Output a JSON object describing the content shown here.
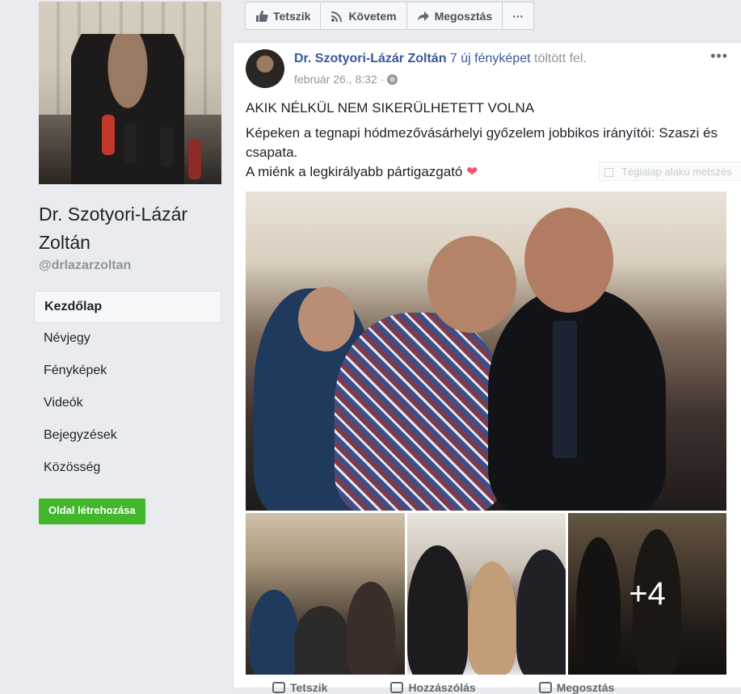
{
  "sidebar": {
    "page_name": "Dr. Szotyori-Lázár Zoltán",
    "page_handle": "@drlazarzoltan",
    "nav_items": [
      {
        "label": "Kezdőlap",
        "active": true
      },
      {
        "label": "Névjegy",
        "active": false
      },
      {
        "label": "Fényképek",
        "active": false
      },
      {
        "label": "Videók",
        "active": false
      },
      {
        "label": "Bejegyzések",
        "active": false
      },
      {
        "label": "Közösség",
        "active": false
      }
    ],
    "create_page_label": "Oldal létrehozása"
  },
  "action_bar": {
    "like_label": "Tetszik",
    "follow_label": "Követem",
    "share_label": "Megosztás",
    "more_label": "···",
    "like_icon": "thumbs-up-icon",
    "follow_icon": "rss-icon",
    "share_icon": "share-arrow-icon"
  },
  "post": {
    "author": "Dr. Szotyori-Lázár Zoltán",
    "action_link": "7 új fényképet",
    "action_suffix": "töltött fel.",
    "date": "február 26., 8:32",
    "separator": "·",
    "audience_icon": "globe-icon",
    "menu_label": "•••",
    "headline": "AKIK NÉLKÜL NEM SIKERÜLHETETT VOLNA",
    "body_line1": "Képeken a tegnapi hódmezővásárhelyi győzelem jobbikos irányítói: Szaszi és csapata.",
    "body_line2": "A miénk a legkirályabb pártigazgató",
    "heart": "❤",
    "tooltip_text": "Téglalap alakú metszés",
    "more_photos_label": "+4"
  },
  "bottom_actions": {
    "like_partial": "Tetszik",
    "comment_partial": "Hozzászólás",
    "share_partial": "Megosztás"
  },
  "colors": {
    "link": "#365899",
    "button_green": "#42b72a",
    "background": "#e9ebee"
  }
}
